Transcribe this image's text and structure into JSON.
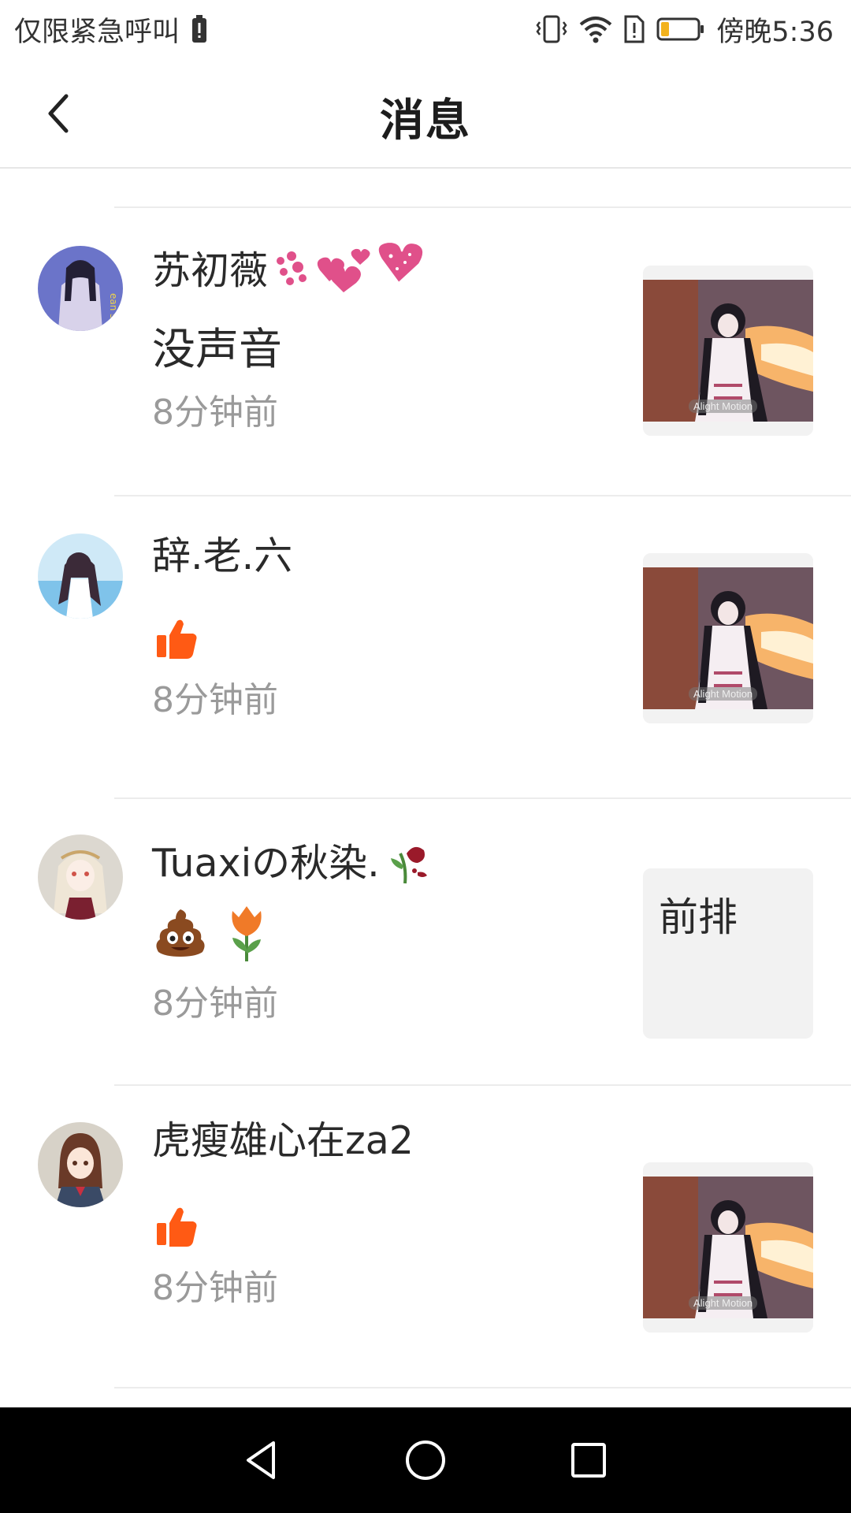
{
  "status_bar": {
    "left_text": "仅限紧急呼叫",
    "time": "傍晚5:36",
    "icons": [
      "battery-alert-icon",
      "vibrate-icon",
      "wifi-icon",
      "sim-alert-icon",
      "battery-icon"
    ]
  },
  "header": {
    "title": "消息",
    "back_icon": "back-arrow-icon"
  },
  "messages": [
    {
      "name": "苏初薇",
      "name_emoji": "hearts-emoji",
      "content": "没声音",
      "time": "8分钟前",
      "thumb_type": "image",
      "thumb_watermark": "Alight Motion"
    },
    {
      "name": "辞.老.六",
      "content_emoji": "thumbs-up-emoji",
      "time": "8分钟前",
      "thumb_type": "image",
      "thumb_watermark": "Alight Motion"
    },
    {
      "name": "Tuaxiの秋染.",
      "name_emoji": "wilted-rose-emoji",
      "content_emoji": [
        "poop-emoji",
        "tulip-emoji"
      ],
      "time": "8分钟前",
      "thumb_type": "text",
      "thumb_text": "前排"
    },
    {
      "name": "虎瘦雄心在za2",
      "content_emoji": "thumbs-up-emoji",
      "time": "8分钟前",
      "thumb_type": "image",
      "thumb_watermark": "Alight Motion"
    }
  ],
  "nav_bar": {
    "icons": [
      "nav-back-icon",
      "nav-home-icon",
      "nav-recents-icon"
    ]
  },
  "colors": {
    "accent_orange": "#ff5a14",
    "time_gray": "#9a9a9a",
    "heart_pink": "#e0508a"
  }
}
